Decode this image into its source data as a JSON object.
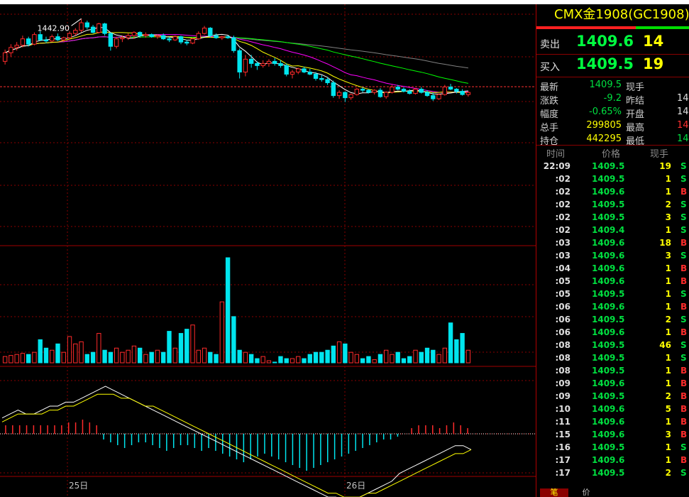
{
  "chart": {
    "high_label": "1442.90",
    "date_labels": [
      "25日",
      "26日"
    ]
  },
  "colors": {
    "up": "#ff2b2b",
    "down": "#00e5ee",
    "ma5": "#ffffff",
    "ma10": "#ffff00",
    "ma20": "#ff00ff",
    "ma40": "#00ff00",
    "ma60": "#808080",
    "grid": "#8a0000"
  },
  "sidebar": {
    "title": "CMX金1908(GC1908)",
    "sell": {
      "label": "卖出",
      "price": "1409.6",
      "vol": "14"
    },
    "buy": {
      "label": "买入",
      "price": "1409.5",
      "vol": "19"
    },
    "stats": [
      {
        "label": "最新",
        "value": "1409.5",
        "value_color": "#00e040",
        "label2": "现手",
        "value2": "",
        "value2_color": "#ffff00"
      },
      {
        "label": "涨跌",
        "value": "-9.2",
        "value_color": "#00e040",
        "label2": "昨结",
        "value2": "14",
        "value2_color": "#e0e0e0"
      },
      {
        "label": "幅度",
        "value": "-0.65%",
        "value_color": "#00e040",
        "label2": "开盘",
        "value2": "14",
        "value2_color": "#e0e0e0"
      },
      {
        "label": "总手",
        "value": "299805",
        "value_color": "#ffff00",
        "label2": "最高",
        "value2": "14",
        "value2_color": "#ff3030"
      },
      {
        "label": "持仓",
        "value": "442295",
        "value_color": "#ffff00",
        "label2": "最低",
        "value2": "14",
        "value2_color": "#00e040"
      }
    ],
    "tick_headers": [
      "时间",
      "价格",
      "现手"
    ],
    "ticks": [
      {
        "time": "22:09",
        "price": "1409.5",
        "vol": "19",
        "bs": "S"
      },
      {
        "time": ":02",
        "price": "1409.5",
        "vol": "1",
        "bs": "S"
      },
      {
        "time": ":02",
        "price": "1409.6",
        "vol": "1",
        "bs": "B"
      },
      {
        "time": ":02",
        "price": "1409.5",
        "vol": "2",
        "bs": "S"
      },
      {
        "time": ":02",
        "price": "1409.5",
        "vol": "3",
        "bs": "S"
      },
      {
        "time": ":02",
        "price": "1409.4",
        "vol": "1",
        "bs": "S"
      },
      {
        "time": ":03",
        "price": "1409.6",
        "vol": "18",
        "bs": "B"
      },
      {
        "time": ":03",
        "price": "1409.6",
        "vol": "3",
        "bs": "S"
      },
      {
        "time": ":04",
        "price": "1409.6",
        "vol": "1",
        "bs": "B"
      },
      {
        "time": ":05",
        "price": "1409.6",
        "vol": "1",
        "bs": "B"
      },
      {
        "time": ":05",
        "price": "1409.5",
        "vol": "1",
        "bs": "S"
      },
      {
        "time": ":06",
        "price": "1409.6",
        "vol": "1",
        "bs": "B"
      },
      {
        "time": ":06",
        "price": "1409.5",
        "vol": "2",
        "bs": "S"
      },
      {
        "time": ":06",
        "price": "1409.6",
        "vol": "1",
        "bs": "B"
      },
      {
        "time": ":08",
        "price": "1409.5",
        "vol": "46",
        "bs": "S"
      },
      {
        "time": ":08",
        "price": "1409.5",
        "vol": "1",
        "bs": "S"
      },
      {
        "time": ":08",
        "price": "1409.5",
        "vol": "1",
        "bs": "B"
      },
      {
        "time": ":09",
        "price": "1409.6",
        "vol": "1",
        "bs": "B"
      },
      {
        "time": ":09",
        "price": "1409.5",
        "vol": "2",
        "bs": "B"
      },
      {
        "time": ":10",
        "price": "1409.6",
        "vol": "5",
        "bs": "B"
      },
      {
        "time": ":11",
        "price": "1409.6",
        "vol": "1",
        "bs": "B"
      },
      {
        "time": ":15",
        "price": "1409.6",
        "vol": "3",
        "bs": "B"
      },
      {
        "time": ":16",
        "price": "1409.5",
        "vol": "1",
        "bs": "S"
      },
      {
        "time": ":17",
        "price": "1409.6",
        "vol": "1",
        "bs": "B"
      },
      {
        "time": ":17",
        "price": "1409.5",
        "vol": "2",
        "bs": "S"
      }
    ],
    "tabs": [
      "笔",
      "价"
    ]
  },
  "chart_data": [
    {
      "type": "candlestick",
      "title": "",
      "up_color": "#ff2b2b",
      "down_color": "#00e5ee",
      "y_range": [
        1385,
        1445
      ],
      "candles": [
        [
          1423.0,
          1428.5,
          1421.5,
          1427.0
        ],
        [
          1427.0,
          1431.0,
          1425.0,
          1429.5
        ],
        [
          1429.5,
          1432.0,
          1428.0,
          1430.5
        ],
        [
          1430.5,
          1435.0,
          1429.5,
          1433.5
        ],
        [
          1433.5,
          1434.5,
          1430.0,
          1431.0
        ],
        [
          1431.0,
          1436.5,
          1430.5,
          1435.5
        ],
        [
          1435.5,
          1437.0,
          1432.5,
          1433.0
        ],
        [
          1433.0,
          1434.5,
          1431.5,
          1432.5
        ],
        [
          1432.5,
          1435.5,
          1432.0,
          1434.5
        ],
        [
          1434.5,
          1436.0,
          1432.5,
          1433.0
        ],
        [
          1433.0,
          1434.5,
          1432.0,
          1434.0
        ],
        [
          1434.0,
          1437.0,
          1433.0,
          1436.0
        ],
        [
          1436.0,
          1438.5,
          1435.0,
          1437.5
        ],
        [
          1437.5,
          1442.9,
          1436.5,
          1441.0
        ],
        [
          1441.0,
          1442.0,
          1438.0,
          1439.0
        ],
        [
          1439.0,
          1440.0,
          1436.0,
          1436.5
        ],
        [
          1436.5,
          1441.0,
          1436.0,
          1440.5
        ],
        [
          1440.5,
          1441.0,
          1435.0,
          1436.0
        ],
        [
          1436.0,
          1436.5,
          1428.0,
          1430.0
        ],
        [
          1430.0,
          1434.5,
          1429.0,
          1433.5
        ],
        [
          1433.5,
          1435.0,
          1432.0,
          1434.0
        ],
        [
          1434.0,
          1436.0,
          1433.0,
          1435.0
        ],
        [
          1435.0,
          1437.0,
          1433.5,
          1436.5
        ],
        [
          1436.5,
          1437.0,
          1434.0,
          1435.0
        ],
        [
          1435.0,
          1436.5,
          1434.0,
          1435.5
        ],
        [
          1435.5,
          1436.0,
          1434.0,
          1434.5
        ],
        [
          1434.5,
          1435.5,
          1433.5,
          1435.0
        ],
        [
          1435.0,
          1436.0,
          1433.0,
          1433.5
        ],
        [
          1433.5,
          1434.5,
          1432.0,
          1433.0
        ],
        [
          1433.0,
          1435.0,
          1432.5,
          1434.5
        ],
        [
          1434.5,
          1435.0,
          1431.0,
          1432.0
        ],
        [
          1432.0,
          1433.0,
          1430.5,
          1431.5
        ],
        [
          1431.5,
          1434.0,
          1431.0,
          1433.5
        ],
        [
          1433.5,
          1437.0,
          1433.0,
          1436.0
        ],
        [
          1436.0,
          1439.5,
          1435.5,
          1438.5
        ],
        [
          1438.5,
          1439.0,
          1434.0,
          1435.0
        ],
        [
          1435.0,
          1436.0,
          1433.5,
          1434.0
        ],
        [
          1434.0,
          1435.0,
          1433.0,
          1434.5
        ],
        [
          1434.5,
          1435.0,
          1433.5,
          1434.0
        ],
        [
          1434.0,
          1435.0,
          1427.0,
          1428.0
        ],
        [
          1428.0,
          1429.0,
          1415.0,
          1418.0
        ],
        [
          1418.0,
          1426.0,
          1416.0,
          1424.0
        ],
        [
          1424.0,
          1426.0,
          1420.0,
          1422.0
        ],
        [
          1422.0,
          1423.0,
          1419.0,
          1421.0
        ],
        [
          1421.0,
          1423.5,
          1420.0,
          1422.0
        ],
        [
          1422.0,
          1424.0,
          1420.5,
          1423.0
        ],
        [
          1423.0,
          1424.5,
          1421.0,
          1422.0
        ],
        [
          1422.0,
          1423.5,
          1420.0,
          1421.0
        ],
        [
          1421.0,
          1422.0,
          1416.0,
          1417.0
        ],
        [
          1417.0,
          1419.0,
          1415.0,
          1418.0
        ],
        [
          1418.0,
          1420.0,
          1417.0,
          1419.5
        ],
        [
          1419.5,
          1420.5,
          1417.5,
          1418.0
        ],
        [
          1418.0,
          1419.5,
          1416.5,
          1417.0
        ],
        [
          1417.0,
          1418.0,
          1414.0,
          1415.0
        ],
        [
          1415.0,
          1416.5,
          1413.5,
          1414.5
        ],
        [
          1414.5,
          1415.5,
          1412.0,
          1413.0
        ],
        [
          1413.0,
          1414.0,
          1406.0,
          1407.0
        ],
        [
          1407.0,
          1409.5,
          1405.5,
          1408.5
        ],
        [
          1408.5,
          1409.0,
          1404.0,
          1406.0
        ],
        [
          1406.0,
          1408.0,
          1405.0,
          1407.5
        ],
        [
          1407.5,
          1410.5,
          1407.0,
          1410.0
        ],
        [
          1410.0,
          1411.0,
          1408.5,
          1409.5
        ],
        [
          1409.5,
          1410.0,
          1408.0,
          1408.5
        ],
        [
          1408.5,
          1410.0,
          1407.5,
          1409.5
        ],
        [
          1409.5,
          1410.5,
          1406.0,
          1406.5
        ],
        [
          1406.5,
          1409.0,
          1405.5,
          1408.5
        ],
        [
          1408.5,
          1412.0,
          1408.0,
          1411.0
        ],
        [
          1411.0,
          1412.0,
          1409.5,
          1410.0
        ],
        [
          1410.0,
          1411.0,
          1408.5,
          1409.0
        ],
        [
          1409.0,
          1410.0,
          1407.5,
          1408.0
        ],
        [
          1408.0,
          1410.5,
          1407.5,
          1410.0
        ],
        [
          1410.0,
          1411.0,
          1408.0,
          1408.5
        ],
        [
          1408.5,
          1409.5,
          1406.5,
          1407.0
        ],
        [
          1407.0,
          1408.5,
          1404.5,
          1405.5
        ],
        [
          1405.5,
          1408.0,
          1405.0,
          1407.5
        ],
        [
          1407.5,
          1412.0,
          1407.0,
          1411.0
        ],
        [
          1411.0,
          1412.5,
          1409.5,
          1410.0
        ],
        [
          1410.0,
          1410.5,
          1408.0,
          1409.0
        ],
        [
          1409.0,
          1410.0,
          1407.0,
          1407.5
        ],
        [
          1407.5,
          1409.0,
          1406.5,
          1408.5
        ]
      ]
    },
    {
      "type": "bar",
      "title": "",
      "y_range": [
        0,
        100
      ],
      "values": [
        6,
        7,
        8,
        9,
        8,
        10,
        22,
        14,
        12,
        18,
        10,
        25,
        18,
        20,
        8,
        10,
        28,
        12,
        10,
        14,
        10,
        12,
        16,
        14,
        8,
        10,
        12,
        10,
        30,
        14,
        28,
        32,
        36,
        12,
        14,
        10,
        8,
        58,
        100,
        44,
        12,
        10,
        8,
        4,
        6,
        2,
        0,
        6,
        4,
        4,
        6,
        4,
        8,
        10,
        10,
        12,
        16,
        20,
        18,
        10,
        8,
        4,
        6,
        3,
        8,
        12,
        8,
        10,
        4,
        6,
        12,
        10,
        14,
        12,
        8,
        14,
        38,
        22,
        28,
        12
      ]
    },
    {
      "type": "line",
      "title": "",
      "y_range": [
        -18,
        14
      ],
      "series": [
        {
          "color": "#ffffff",
          "values": [
            4,
            5,
            6,
            5,
            5,
            6,
            7,
            7,
            8,
            8,
            9,
            10,
            11,
            12,
            11,
            10,
            9,
            8,
            7,
            6,
            5,
            4,
            3,
            2,
            1,
            0,
            -1,
            -2,
            -3,
            -4,
            -5,
            -6,
            -7,
            -8,
            -9,
            -10,
            -11,
            -12,
            -13,
            -14,
            -15,
            -16,
            -16,
            -17,
            -17,
            -16,
            -15,
            -14,
            -13,
            -12,
            -10,
            -9,
            -8,
            -7,
            -6,
            -5,
            -4,
            -3,
            -3,
            -4
          ]
        },
        {
          "color": "#ffff00",
          "values": [
            3,
            4,
            5,
            5,
            5,
            5,
            6,
            6,
            7,
            7,
            8,
            9,
            10,
            10,
            10,
            9,
            9,
            8,
            7,
            7,
            6,
            5,
            4,
            3,
            2,
            1,
            0,
            -1,
            -2,
            -3,
            -4,
            -5,
            -6,
            -7,
            -8,
            -9,
            -10,
            -11,
            -12,
            -13,
            -14,
            -15,
            -15,
            -16,
            -16,
            -16,
            -15,
            -15,
            -14,
            -13,
            -12,
            -11,
            -10,
            -9,
            -8,
            -7,
            -6,
            -5,
            -5,
            -4
          ]
        }
      ],
      "hist": [
        3,
        3,
        3,
        3,
        3,
        3,
        3,
        3,
        3,
        4,
        4,
        5,
        4,
        3,
        -2,
        -3,
        -4,
        -5,
        -4,
        -3,
        -3,
        -4,
        -5,
        -6,
        -5,
        -4,
        -4,
        -5,
        -6,
        -5,
        -6,
        -7,
        -8,
        -9,
        -10,
        -9,
        -8,
        -7,
        -8,
        -9,
        -10,
        -11,
        -12,
        -13,
        -12,
        -11,
        -10,
        -9,
        -8,
        -7,
        -6,
        -5,
        -4,
        -3,
        -2,
        -2,
        -1,
        0,
        2,
        3,
        3,
        3,
        2,
        3,
        4,
        3,
        2
      ]
    }
  ]
}
